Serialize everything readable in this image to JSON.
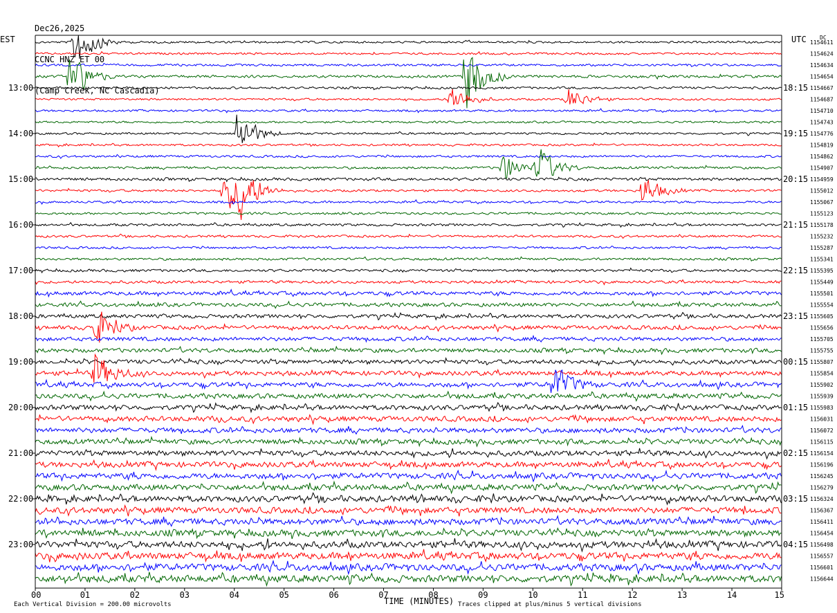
{
  "header": {
    "date": "Dec26,2025",
    "channel": "CCNC HNZ ET 00",
    "location": "(Camp Creek, NC Cascadia)"
  },
  "axes": {
    "left_timezone": "EST",
    "right_timezone": "UTC",
    "right_corner_label": "DC",
    "xlabel": "TIME (MINUTES)",
    "footer_left": "Each Vertical Division =  200.00 microvolts",
    "footer_right": "Traces clipped at plus/minus 5 vertical divisions"
  },
  "colors": {
    "trace_cycle": [
      "#000000",
      "#ff0000",
      "#0000ff",
      "#006600"
    ],
    "background": "#ffffff",
    "gridline": "#000000"
  },
  "chart_data": {
    "type": "line",
    "subtype": "helicorder",
    "title": "",
    "xlim": [
      0,
      15
    ],
    "x_ticks": [
      "00",
      "01",
      "02",
      "03",
      "04",
      "05",
      "06",
      "07",
      "08",
      "09",
      "10",
      "11",
      "12",
      "13",
      "14",
      "15"
    ],
    "lines_per_hour": 4,
    "minutes_per_line": 15,
    "left_hour_labels": [
      "13:00",
      "14:00",
      "15:00",
      "16:00",
      "17:00",
      "18:00",
      "19:00",
      "20:00",
      "21:00",
      "22:00",
      "23:00"
    ],
    "right_hour_labels": [
      "18:15",
      "19:15",
      "20:15",
      "21:15",
      "22:15",
      "23:15",
      "00:15",
      "01:15",
      "02:15",
      "03:15",
      "04:15"
    ],
    "first_labeled_line_index": 4,
    "trace_counts": [
      "1154611",
      "1154624",
      "1154634",
      "1154654",
      "1154667",
      "1154687",
      "1154710",
      "1154743",
      "1154776",
      "1154819",
      "1154862",
      "1154907",
      "1154959",
      "1155012",
      "1155067",
      "1155123",
      "1155178",
      "1155232",
      "1155287",
      "1155341",
      "1155395",
      "1155449",
      "1155501",
      "1155554",
      "1155605",
      "1155656",
      "1155705",
      "1155755",
      "1155807",
      "1155854",
      "1155902",
      "1155939",
      "1155983",
      "1156031",
      "1156072",
      "1156115",
      "1156154",
      "1156196",
      "1156245",
      "1156279",
      "1156324",
      "1156367",
      "1156411",
      "1156454",
      "1156498",
      "1156557",
      "1156601",
      "1156644"
    ],
    "noise_level": [
      0.55,
      0.55,
      0.6,
      0.7,
      0.6,
      0.55,
      0.55,
      0.55,
      0.55,
      0.55,
      0.6,
      0.65,
      0.75,
      0.6,
      0.6,
      0.6,
      0.65,
      0.6,
      0.6,
      0.65,
      0.7,
      0.75,
      1.0,
      1.0,
      1.0,
      1.05,
      1.05,
      1.1,
      1.15,
      1.2,
      1.25,
      1.3,
      1.3,
      1.35,
      1.35,
      1.35,
      1.4,
      1.45,
      1.5,
      1.55,
      1.6,
      1.6,
      1.65,
      1.7,
      1.75,
      1.8,
      1.8,
      1.85
    ],
    "events": [
      {
        "line": 0,
        "minute": 0.8,
        "amplitude": 3.5
      },
      {
        "line": 3,
        "minute": 0.7,
        "amplitude": 3.2
      },
      {
        "line": 3,
        "minute": 8.65,
        "amplitude": 4.5
      },
      {
        "line": 5,
        "minute": 8.35,
        "amplitude": 1.8
      },
      {
        "line": 5,
        "minute": 10.7,
        "amplitude": 1.5
      },
      {
        "line": 8,
        "minute": 4.05,
        "amplitude": 3.0
      },
      {
        "line": 11,
        "minute": 9.4,
        "amplitude": 1.8
      },
      {
        "line": 11,
        "minute": 10.1,
        "amplitude": 2.5
      },
      {
        "line": 13,
        "minute": 3.8,
        "amplitude": 2.8
      },
      {
        "line": 13,
        "minute": 4.1,
        "amplitude": 3.0
      },
      {
        "line": 13,
        "minute": 12.2,
        "amplitude": 2.0
      },
      {
        "line": 25,
        "minute": 1.2,
        "amplitude": 2.5
      },
      {
        "line": 29,
        "minute": 1.2,
        "amplitude": 2.5
      },
      {
        "line": 30,
        "minute": 10.4,
        "amplitude": 2.5
      }
    ]
  }
}
